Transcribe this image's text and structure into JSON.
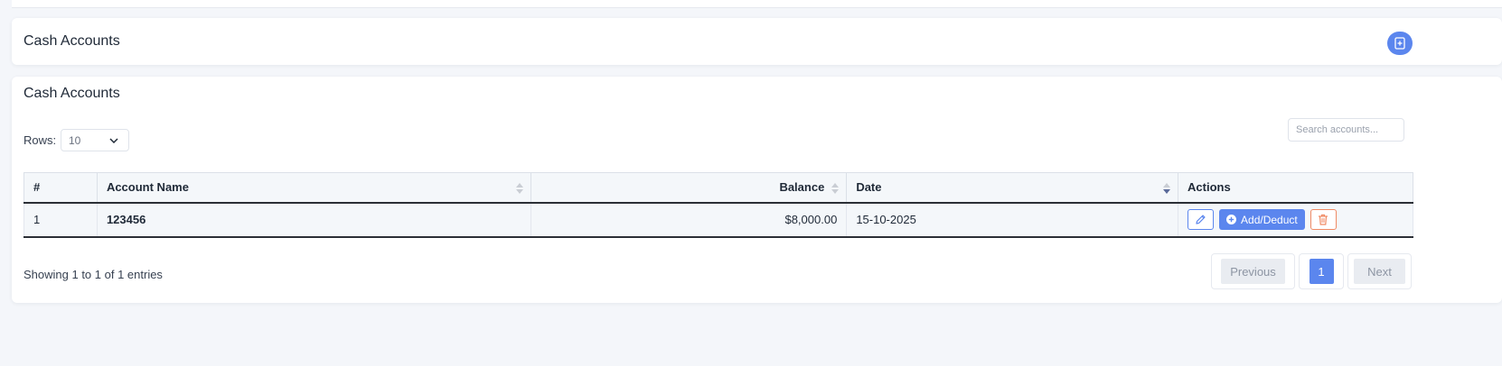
{
  "header": {
    "title": "Cash Accounts",
    "add_icon": "add-file-icon"
  },
  "main": {
    "title": "Cash Accounts",
    "rows_label": "Rows:",
    "rows_value": "10",
    "search_placeholder": "Search accounts..."
  },
  "table": {
    "columns": [
      "#",
      "Account Name",
      "Balance",
      "Date",
      "Actions"
    ],
    "rows": [
      {
        "num": "1",
        "account_name": "123456",
        "balance": "$8,000.00",
        "date": "15-10-2025"
      }
    ],
    "actions": {
      "add_deduct_label": "Add/Deduct",
      "edit_icon": "pencil-icon",
      "delete_icon": "trash-icon"
    }
  },
  "footer": {
    "showing": "Showing 1 to 1 of 1 entries",
    "previous": "Previous",
    "page": "1",
    "next": "Next"
  },
  "colors": {
    "accent": "#5b86ee",
    "danger": "#f08a64",
    "row_bg": "#f4f7fa"
  }
}
